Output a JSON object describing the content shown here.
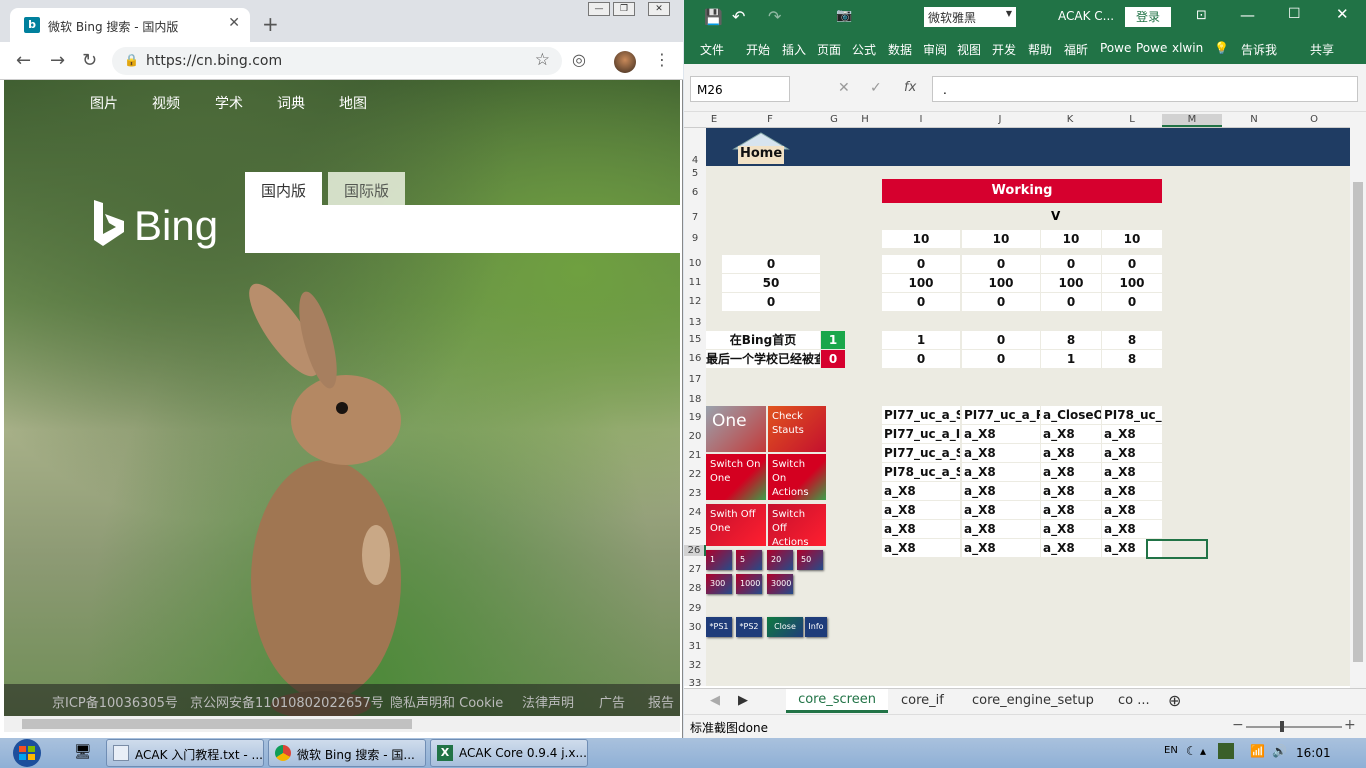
{
  "chrome": {
    "tab_title": "微软 Bing 搜索 - 国内版",
    "tab_close": "✕",
    "new_tab": "+",
    "url": "https://cn.bing.com",
    "win_min": "—",
    "win_max": "❐",
    "win_close": "✕"
  },
  "bing": {
    "nav": [
      "图片",
      "视频",
      "学术",
      "词典",
      "地图"
    ],
    "logo": "Bing",
    "tab_domestic": "国内版",
    "tab_international": "国际版",
    "footer": [
      "京ICP备10036305号",
      "京公网安备11010802022657号",
      "隐私声明和 Cookie",
      "法律声明",
      "广告",
      "报告"
    ]
  },
  "excel": {
    "font_name": "微软雅黑",
    "title": "ACAK C...",
    "login": "登录",
    "ribbon": [
      "文件",
      "开始",
      "插入",
      "页面",
      "公式",
      "数据",
      "审阅",
      "视图",
      "开发",
      "帮助",
      "福昕",
      "Powe",
      "Powe",
      "xlwin",
      "告诉我",
      "共享"
    ],
    "namebox": "M26",
    "formula": ".",
    "fx": "fx",
    "columns": [
      "E",
      "F",
      "G",
      "H",
      "I",
      "J",
      "K",
      "L",
      "M",
      "N",
      "O"
    ],
    "rows": [
      "4",
      "5",
      "6",
      "7",
      "9",
      "10",
      "11",
      "12",
      "13",
      "15",
      "16",
      "17",
      "18",
      "19",
      "20",
      "21",
      "22",
      "23",
      "24",
      "25",
      "26",
      "27",
      "28",
      "29",
      "30",
      "31",
      "32",
      "33"
    ],
    "home_label": "Home",
    "working_label": "Working",
    "v_label": "V",
    "row9": [
      "10",
      "10",
      "10",
      "10"
    ],
    "row10": {
      "f": "0",
      "vals": [
        "0",
        "0",
        "0",
        "0"
      ]
    },
    "row11": {
      "f": "50",
      "vals": [
        "100",
        "100",
        "100",
        "100"
      ]
    },
    "row12": {
      "f": "0",
      "vals": [
        "0",
        "0",
        "0",
        "0"
      ]
    },
    "row15": {
      "label": "在Bing首页",
      "flag": "1",
      "vals": [
        "1",
        "0",
        "8",
        "8"
      ]
    },
    "row16": {
      "label": "最后一个学校已经被查",
      "flag": "0",
      "vals": [
        "0",
        "0",
        "1",
        "8"
      ]
    },
    "table": [
      [
        "PI77_uc_a_Sh",
        "PI77_uc_a_Pr",
        "a_CloseOr",
        "PI78_uc_a"
      ],
      [
        "PI77_uc_a_Inp",
        "a_X8",
        "a_X8",
        "a_X8"
      ],
      [
        "PI77_uc_a_Se",
        "a_X8",
        "a_X8",
        "a_X8"
      ],
      [
        "PI78_uc_a_Sle",
        "a_X8",
        "a_X8",
        "a_X8"
      ],
      [
        "a_X8",
        "a_X8",
        "a_X8",
        "a_X8"
      ],
      [
        "a_X8",
        "a_X8",
        "a_X8",
        "a_X8"
      ],
      [
        "a_X8",
        "a_X8",
        "a_X8",
        "a_X8"
      ],
      [
        "a_X8",
        "a_X8",
        "a_X8",
        "a_X8"
      ]
    ],
    "tiles": {
      "one": "One",
      "check": "Check Stauts",
      "switch_on_one": "Switch On One",
      "switch_on_actions": "Switch On Actions",
      "swith_off_one": "Swith Off One",
      "switch_off_actions": "Switch Off Actions"
    },
    "small_buttons": [
      "1",
      "5",
      "20",
      "50",
      "300",
      "1000",
      "3000"
    ],
    "bottom_buttons": [
      "*PS1",
      "*PS2",
      "Close",
      "Info"
    ],
    "sheet_tabs": [
      "core_screen",
      "core_if",
      "core_engine_setup",
      "co ..."
    ],
    "status": "标准截图done"
  },
  "taskbar": {
    "items": [
      "ACAK 入门教程.txt - ...",
      "微软 Bing 搜索 - 国...",
      "ACAK Core 0.9.4 j.x..."
    ],
    "lang": "EN",
    "time": "16:01"
  },
  "colors": {
    "excel_green": "#217346",
    "working_red": "#d6002e",
    "header_navy": "#1f3c63",
    "flag_green": "#1aa64a",
    "flag_red": "#d6002e"
  }
}
